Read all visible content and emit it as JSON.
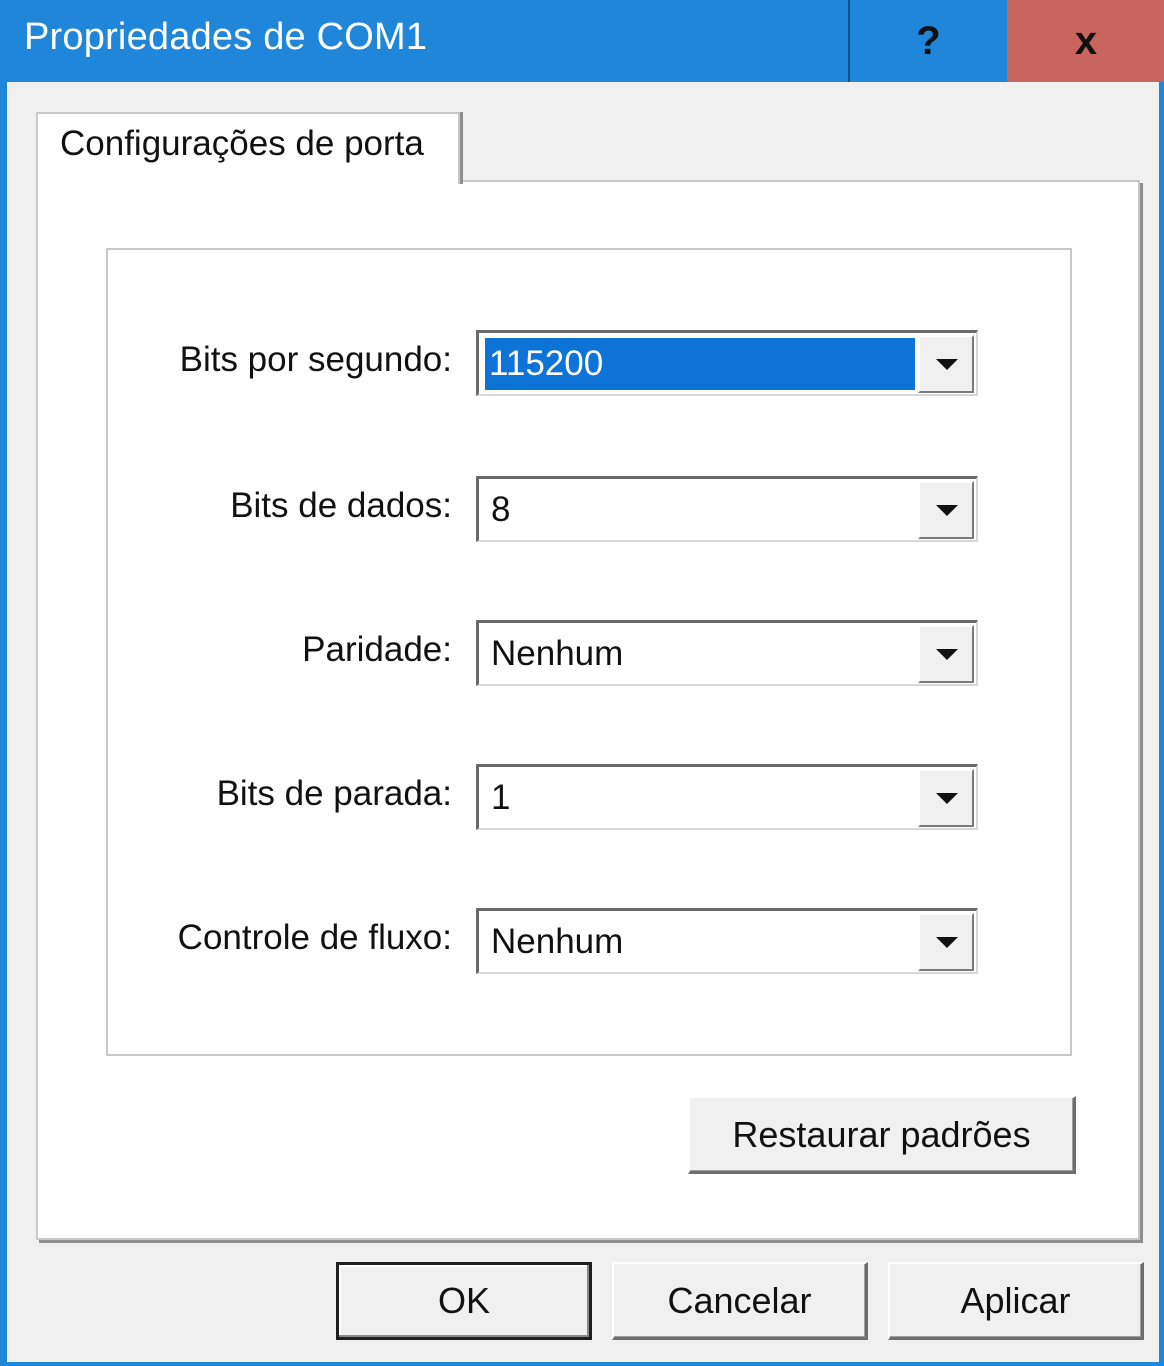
{
  "window": {
    "title": "Propriedades de COM1",
    "help_label": "?",
    "close_label": "x"
  },
  "tabs": [
    {
      "label": "Configurações de porta",
      "active": true
    }
  ],
  "settings": {
    "bits_per_second": {
      "label": "Bits por segundo:",
      "value": "115200",
      "selected": true
    },
    "data_bits": {
      "label": "Bits de dados:",
      "value": "8"
    },
    "parity": {
      "label": "Paridade:",
      "value": "Nenhum"
    },
    "stop_bits": {
      "label": "Bits de parada:",
      "value": "1"
    },
    "flow_control": {
      "label": "Controle de fluxo:",
      "value": "Nenhum"
    }
  },
  "buttons": {
    "restore_defaults": "Restaurar padrões",
    "ok": "OK",
    "cancel": "Cancelar",
    "apply": "Aplicar"
  },
  "colors": {
    "titlebar": "#1f86d9",
    "close_button": "#c7655e",
    "selection": "#0e73d6"
  },
  "icons": {
    "combo_arrow": "chevron-down-icon"
  }
}
